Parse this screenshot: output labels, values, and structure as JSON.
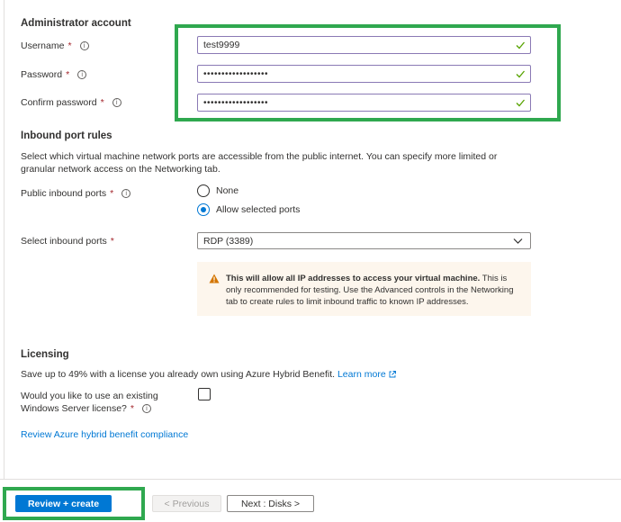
{
  "admin": {
    "heading": "Administrator account",
    "username_label": "Username",
    "username_value": "test9999",
    "password_label": "Password",
    "password_value": "••••••••••••••••••",
    "confirm_label": "Confirm password",
    "confirm_value": "••••••••••••••••••",
    "required_mark": "*",
    "info_glyph": "i",
    "valid_icon": "check-icon"
  },
  "inbound": {
    "heading": "Inbound port rules",
    "description": "Select which virtual machine network ports are accessible from the public internet. You can specify more limited or granular network access on the Networking tab.",
    "public_ports_label": "Public inbound ports",
    "options": [
      "None",
      "Allow selected ports"
    ],
    "selected_option": "Allow selected ports",
    "select_ports_label": "Select inbound ports",
    "select_ports_value": "RDP (3389)",
    "warning_bold": "This will allow all IP addresses to access your virtual machine.",
    "warning_rest": " This is only recommended for testing.  Use the Advanced controls in the Networking tab to create rules to limit inbound traffic to known IP addresses."
  },
  "licensing": {
    "heading": "Licensing",
    "description": "Save up to 49% with a license you already own using Azure Hybrid Benefit.",
    "learn_more": "Learn more",
    "question_line1": "Would you like to use an existing",
    "question_line2": "Windows Server license?",
    "checkbox_checked": false,
    "review_link": "Review Azure hybrid benefit compliance"
  },
  "footer": {
    "review_create": "Review + create",
    "previous": "< Previous",
    "next": "Next : Disks >"
  },
  "colors": {
    "accent": "#0078d4",
    "highlight": "#2fa84f",
    "valid": "#57a300",
    "warning": "#d47500"
  }
}
